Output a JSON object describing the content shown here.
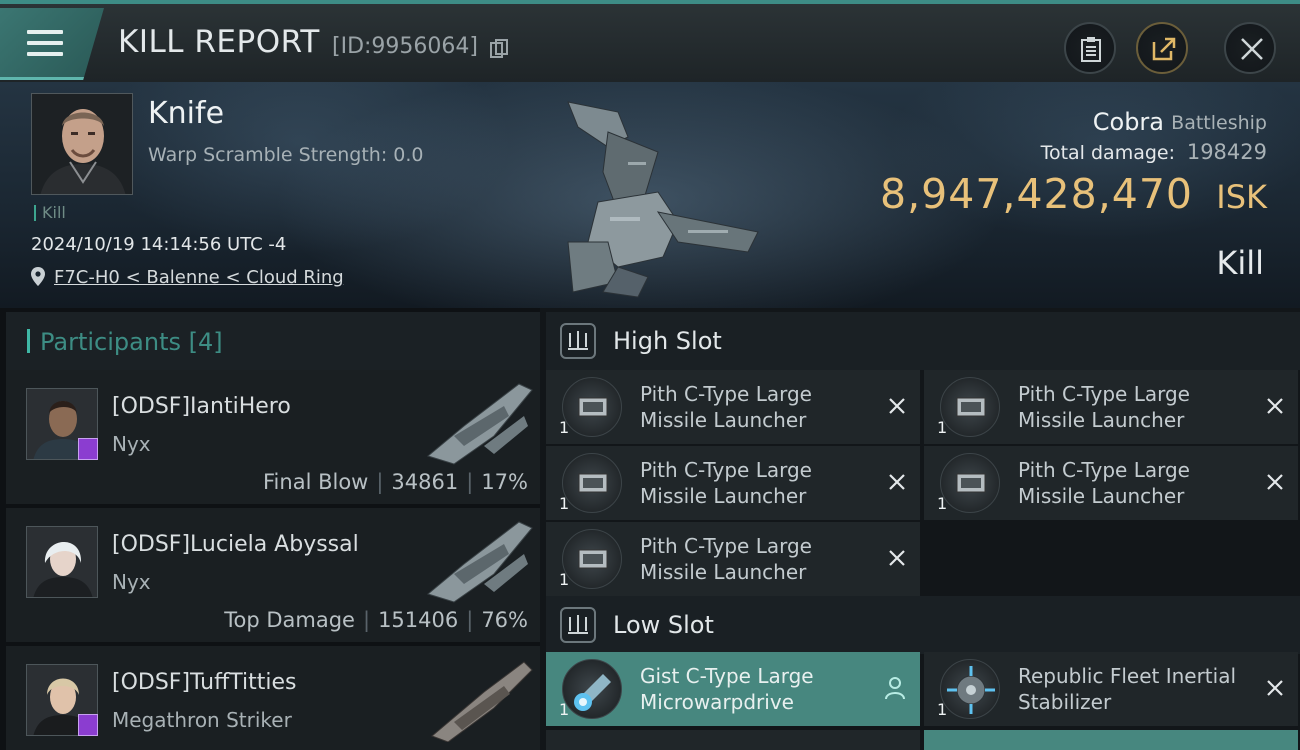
{
  "header": {
    "title": "KILL REPORT",
    "report_id": "[ID:9956064]"
  },
  "victim": {
    "name": "Knife",
    "warp_scramble": "Warp Scramble Strength: 0.0",
    "kill_tag": "Kill",
    "datetime": "2024/10/19 14:14:56 UTC -4",
    "location": "F7C-H0 < Balenne < Cloud Ring",
    "ship_name": "Cobra",
    "ship_class": "Battleship",
    "total_damage_label": "Total damage:",
    "total_damage_value": "198429",
    "isk_value": "8,947,428,470",
    "isk_unit": "ISK",
    "result": "Kill"
  },
  "participants": {
    "title": "Participants [4]",
    "rows": [
      {
        "name": "[ODSF]IantiHero",
        "ship": "Nyx",
        "label": "Final Blow",
        "damage": "34861",
        "percent": "17%"
      },
      {
        "name": "[ODSF]Luciela Abyssal",
        "ship": "Nyx",
        "label": "Top Damage",
        "damage": "151406",
        "percent": "76%"
      },
      {
        "name": "[ODSF]TuffTitties",
        "ship": "Megathron Striker"
      }
    ]
  },
  "fittings": {
    "high_slot_title": "High Slot",
    "low_slot_title": "Low Slot",
    "high_slot": [
      {
        "name": "Pith C-Type Large Missile Launcher",
        "qty": "1"
      },
      {
        "name": "Pith C-Type Large Missile Launcher",
        "qty": "1"
      },
      {
        "name": "Pith C-Type Large Missile Launcher",
        "qty": "1"
      },
      {
        "name": "Pith C-Type Large Missile Launcher",
        "qty": "1"
      },
      {
        "name": "Pith C-Type Large Missile Launcher",
        "qty": "1"
      }
    ],
    "low_slot": [
      {
        "name": "Gist C-Type Large Microwarpdrive",
        "qty": "1"
      },
      {
        "name": "Republic Fleet Inertial Stabilizer",
        "qty": "1"
      }
    ]
  },
  "colors": {
    "accent_teal": "#3fb8a6",
    "isk_gold": "#e8c17a",
    "active_module": "#47877f"
  }
}
